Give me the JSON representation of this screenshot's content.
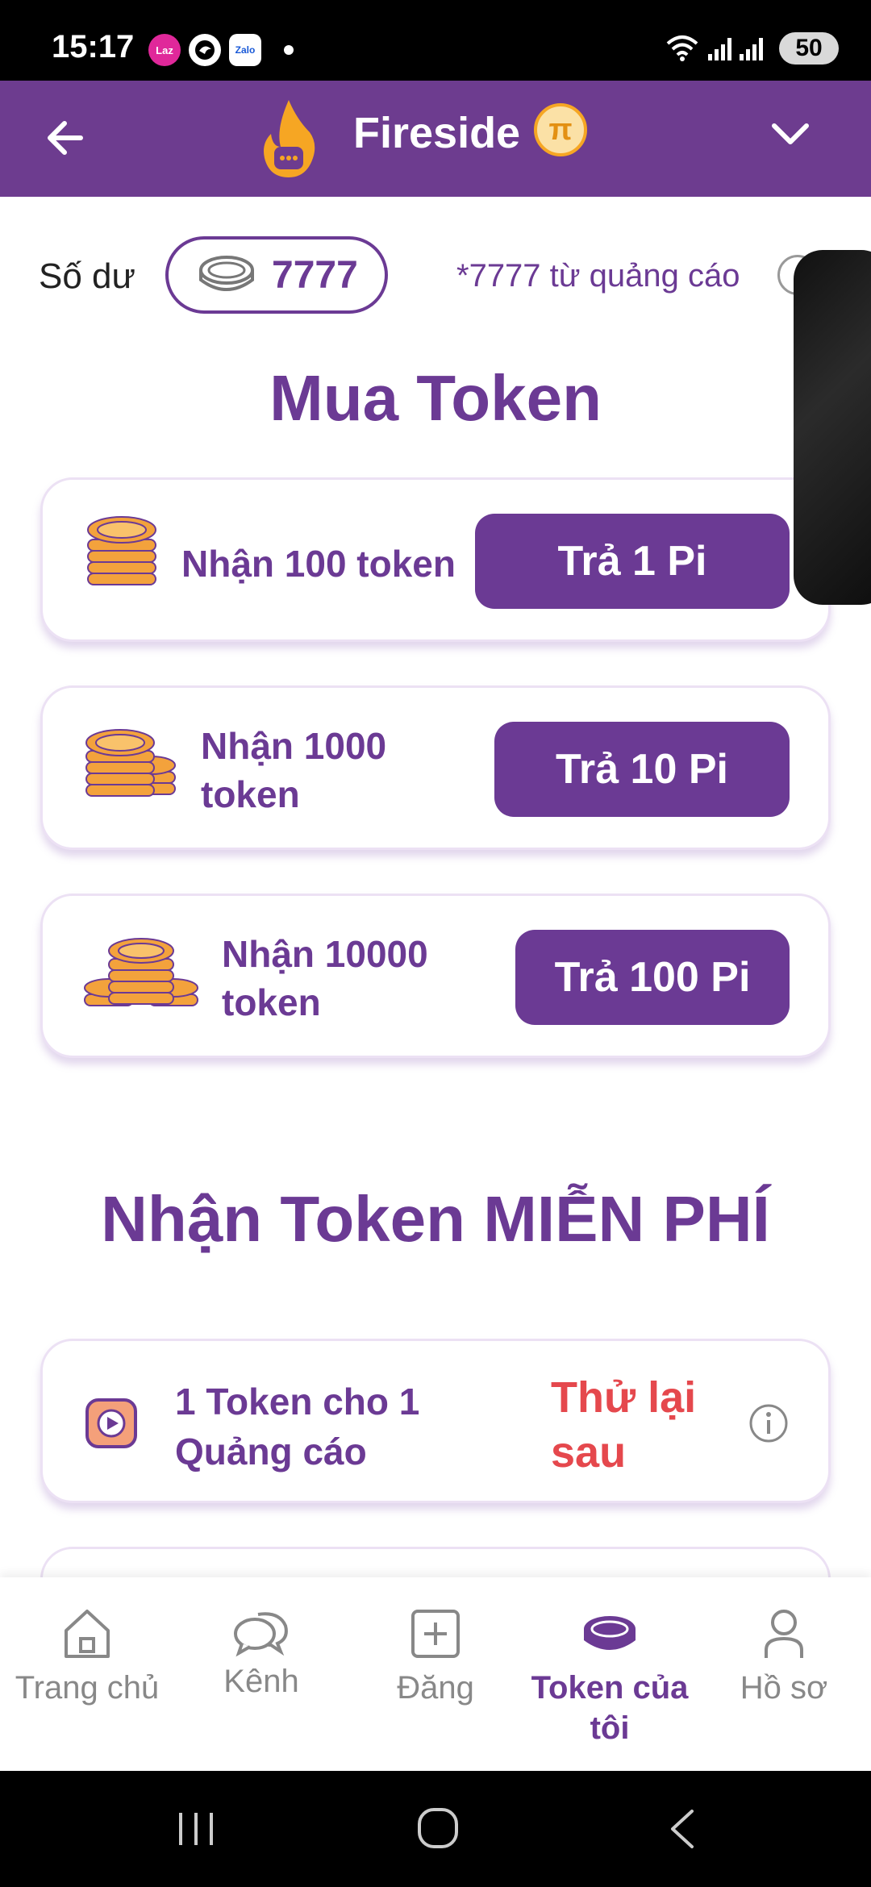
{
  "status_bar": {
    "time": "15:17",
    "notifications": [
      "Laz",
      "Zalo"
    ],
    "battery": "50"
  },
  "header": {
    "title": "Fireside",
    "pi_symbol": "π"
  },
  "balance": {
    "label": "Số dư",
    "value": "7777",
    "ad_note": "*7777 từ quảng cáo"
  },
  "buy_section": {
    "title": "Mua Token",
    "offers": [
      {
        "label": "Nhận 100 token",
        "button": "Trả 1 Pi"
      },
      {
        "label_line1": "Nhận 1000",
        "label_line2": "token",
        "button": "Trả 10 Pi"
      },
      {
        "label_line1": "Nhận 10000",
        "label_line2": "token",
        "button": "Trả 100 Pi"
      }
    ]
  },
  "free_section": {
    "title": "Nhận Token MIỄN PHÍ",
    "items": [
      {
        "line1": "1 Token cho 1",
        "line2": "Quảng cáo",
        "status_line1": "Thử lại",
        "status_line2": "sau"
      }
    ]
  },
  "bottom_nav": {
    "items": [
      {
        "label": "Trang chủ"
      },
      {
        "label": "Kênh"
      },
      {
        "label": "Đăng"
      },
      {
        "label_line1": "Token của",
        "label_line2": "tôi"
      },
      {
        "label": "Hồ sơ"
      }
    ],
    "active_index": 3
  },
  "colors": {
    "primary": "#6d3c8f",
    "accent_text": "#6b3a94",
    "retry": "#e5484d",
    "coin": "#f3a23c"
  }
}
